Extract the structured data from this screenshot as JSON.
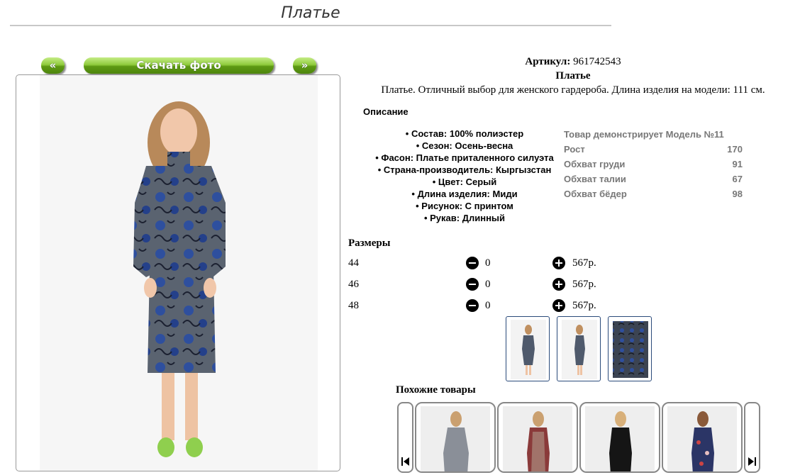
{
  "page": {
    "title": "Платье"
  },
  "gallery": {
    "prev": "«",
    "download": "Скачать фото",
    "next": "»"
  },
  "product": {
    "article_label": "Артикул:",
    "article_value": "961742543",
    "name": "Платье",
    "summary": "Платье. Отличный выбор для женского гардероба. Длина изделия на модели: 111 см."
  },
  "description": {
    "title": "Описание",
    "items": [
      "• Состав: 100% полиэстер",
      "• Сезон: Осень-весна",
      "• Фасон: Платье приталенного силуэта",
      "• Страна-производитель: Кыргызстан",
      "• Цвет: Серый",
      "• Длина изделия: Миди",
      "• Рисунок: С принтом",
      "• Рукав: Длинный"
    ]
  },
  "model": {
    "title": "Товар демонстрирует Модель №11",
    "rows": [
      {
        "label": "Рост",
        "value": "170"
      },
      {
        "label": "Обхват груди",
        "value": "91"
      },
      {
        "label": "Обхват талии",
        "value": "67"
      },
      {
        "label": "Обхват бёдер",
        "value": "98"
      }
    ]
  },
  "sizes": {
    "title": "Размеры",
    "rows": [
      {
        "size": "44",
        "qty": "0",
        "price": "567р."
      },
      {
        "size": "46",
        "qty": "0",
        "price": "567р."
      },
      {
        "size": "48",
        "qty": "0",
        "price": "567р."
      }
    ]
  },
  "similar": {
    "title": "Похожие товары"
  },
  "colors": {
    "accent_green": "#6aa81f",
    "dress_gray": "#5a6370",
    "dress_blue": "#2e4f9e",
    "thumb_border": "#2a4a7a"
  }
}
